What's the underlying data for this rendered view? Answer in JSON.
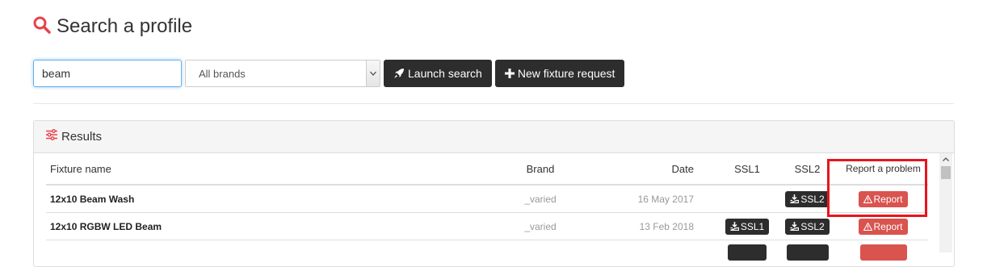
{
  "page": {
    "title": "Search a profile"
  },
  "search": {
    "query": "beam",
    "brand_selected": "All brands",
    "launch_label": "Launch search",
    "new_request_label": "New fixture request"
  },
  "results": {
    "title": "Results",
    "columns": [
      "Fixture name",
      "Brand",
      "Date",
      "SSL1",
      "SSL2",
      "Report a problem"
    ],
    "rows": [
      {
        "name": "12x10 Beam Wash",
        "brand": "_varied",
        "date": "16 May 2017",
        "ssl1": "",
        "ssl2": "SSL2",
        "report": "Report"
      },
      {
        "name": "12x10 RGBW LED Beam",
        "brand": "_varied",
        "date": "13 Feb 2018",
        "ssl1": "SSL1",
        "ssl2": "SSL2",
        "report": "Report"
      }
    ]
  },
  "colors": {
    "accent": "#e8414d",
    "dark_button": "#2d2d2d",
    "report_button": "#d9534f",
    "highlight": "#e8141c"
  },
  "icons": {
    "title": "search-icon",
    "launch": "rocket-icon",
    "new_request": "plus-icon",
    "results": "sliders-icon",
    "ssl": "download-icon",
    "report": "warning-icon"
  }
}
